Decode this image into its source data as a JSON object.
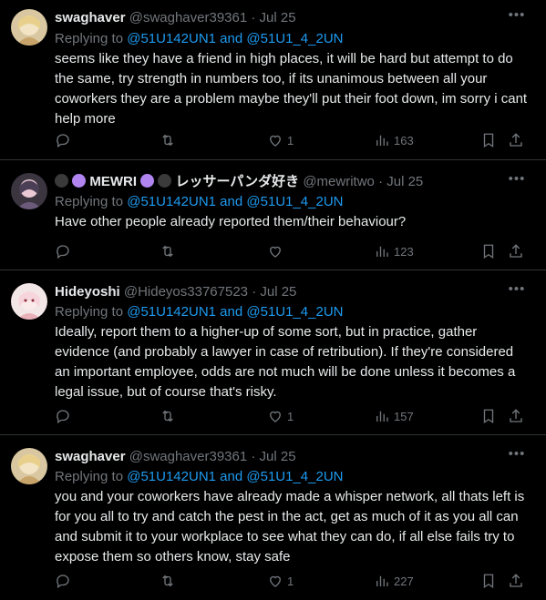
{
  "tweets": [
    {
      "name": "swaghaver",
      "handle": "@swaghaver39361",
      "date": "Jul 25",
      "replying_prefix": "Replying to",
      "mention1": "@51U142UN1",
      "and": "and",
      "mention2": "@51U1_4_2UN",
      "text": "seems like they have a friend in high places, it will be hard but attempt to do the same, try strength in numbers too, if its unanimous between all your coworkers they are a problem maybe they'll put their foot down, im sorry i cant help more",
      "likes": "1",
      "views": "163"
    },
    {
      "name": "MEWRI",
      "name_suffix": "レッサーパンダ好き",
      "handle": "@mewritwo",
      "date": "Jul 25",
      "replying_prefix": "Replying to",
      "mention1": "@51U142UN1",
      "and": "and",
      "mention2": "@51U1_4_2UN",
      "text": "Have other people already reported them/their behaviour?",
      "likes": "",
      "views": "123"
    },
    {
      "name": "Hideyoshi",
      "handle": "@Hideyos33767523",
      "date": "Jul 25",
      "replying_prefix": "Replying to",
      "mention1": "@51U142UN1",
      "and": "and",
      "mention2": "@51U1_4_2UN",
      "text": "Ideally, report them to a higher-up of some sort, but in practice, gather evidence (and probably a lawyer in case of retribution). If they're considered an important employee, odds are not much will be done unless it becomes a legal issue, but of course that's risky.",
      "likes": "1",
      "views": "157"
    },
    {
      "name": "swaghaver",
      "handle": "@swaghaver39361",
      "date": "Jul 25",
      "replying_prefix": "Replying to",
      "mention1": "@51U142UN1",
      "and": "and",
      "mention2": "@51U1_4_2UN",
      "text": "you and your coworkers have already made a whisper network, all thats left is for you all to try and catch the pest in the act, get as much of it as you all can and submit it to your workplace to see what they can do, if all else fails try to expose them so others know, stay safe",
      "likes": "1",
      "views": "227"
    }
  ],
  "separator": "·",
  "colors": {
    "background": "#000000",
    "text": "#e7e9ea",
    "muted": "#71767b",
    "link": "#1d9bf0",
    "border": "#2f3336",
    "heart_purple": "#b185f0",
    "heart_black": "#3a3a3a"
  },
  "icons": [
    "reply-icon",
    "retweet-icon",
    "like-icon",
    "views-icon",
    "bookmark-icon",
    "share-icon",
    "more-icon"
  ]
}
